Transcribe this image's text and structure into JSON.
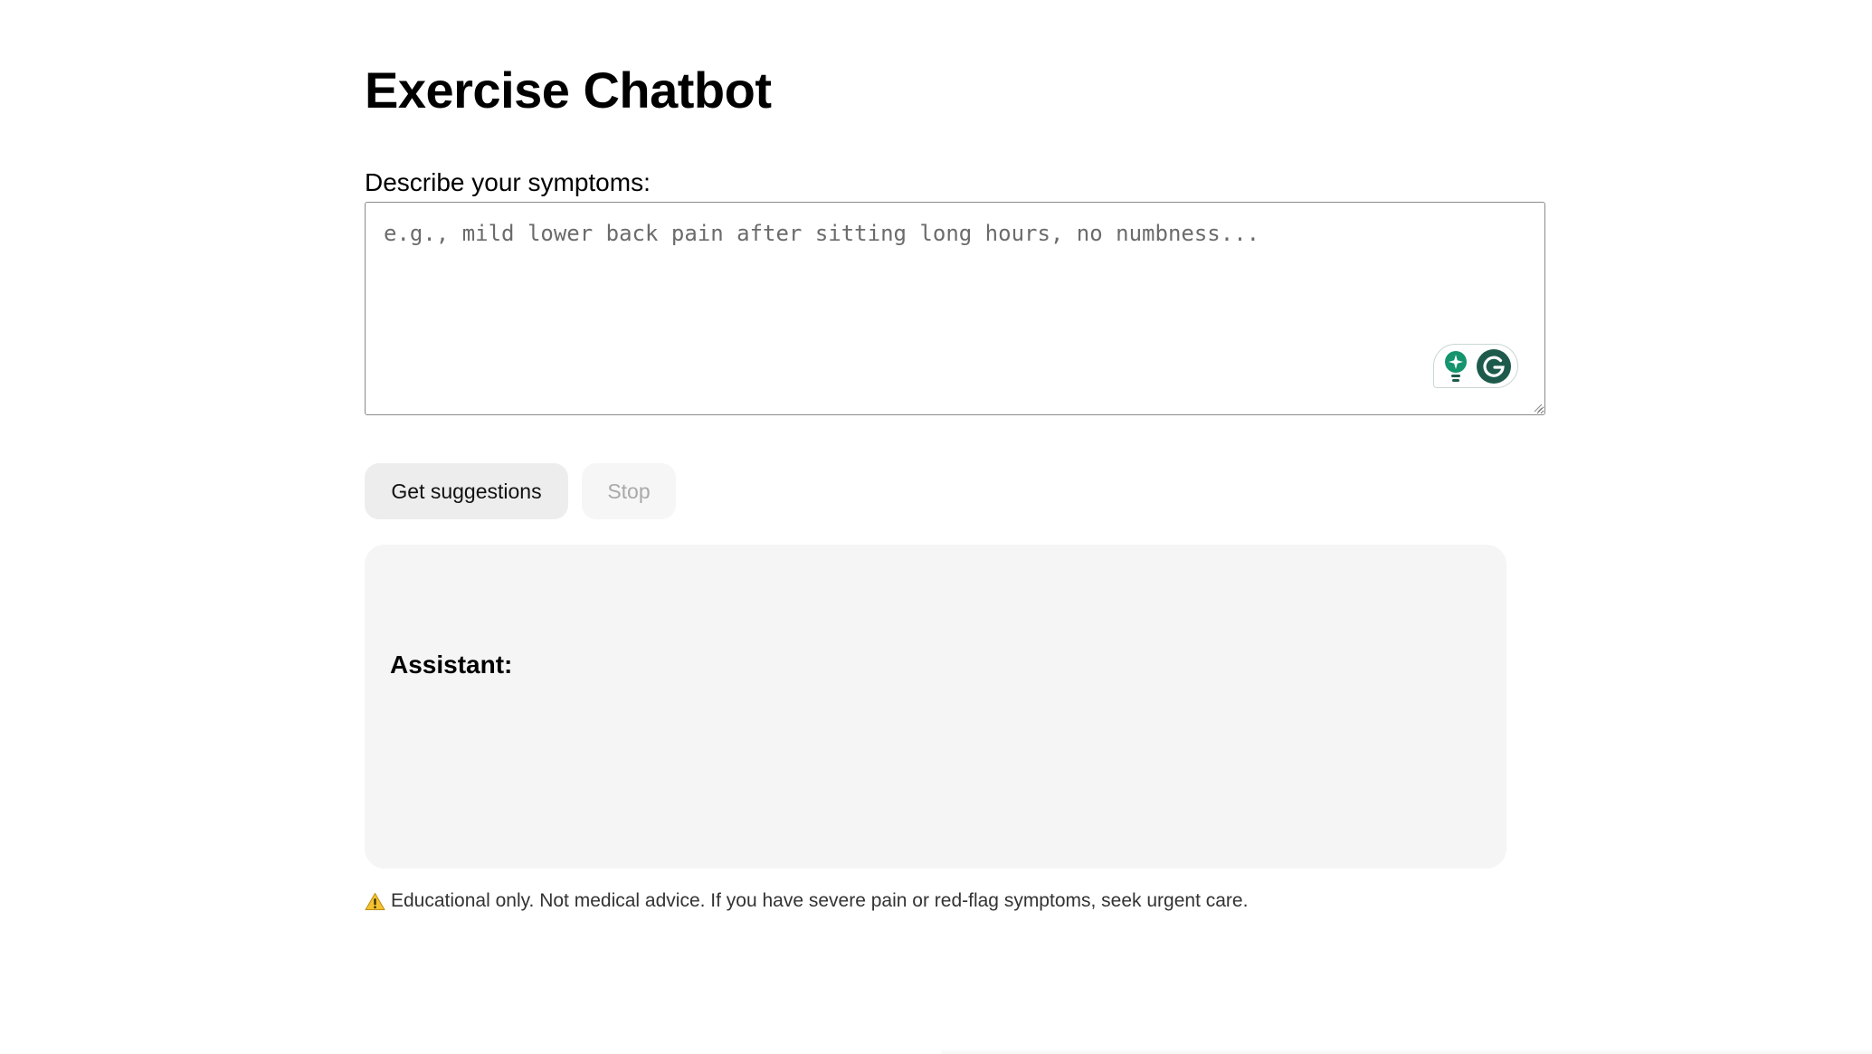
{
  "page": {
    "title": "Exercise Chatbot"
  },
  "symptoms": {
    "label": "Describe your symptoms:",
    "value": "",
    "placeholder": "e.g., mild lower back pain after sitting long hours, no numbness..."
  },
  "grammarly": {
    "bulb_icon": "lightbulb-icon",
    "logo_icon": "grammarly-g-icon",
    "accent_color": "#15946e",
    "logo_color": "#1d5a4c"
  },
  "actions": {
    "submit_label": "Get suggestions",
    "stop_label": "Stop"
  },
  "assistant": {
    "label": "Assistant:",
    "output": ""
  },
  "disclaimer": {
    "icon": "warning-icon",
    "text": "Educational only. Not medical advice. If you have severe pain or red-flag symptoms, seek urgent care."
  }
}
